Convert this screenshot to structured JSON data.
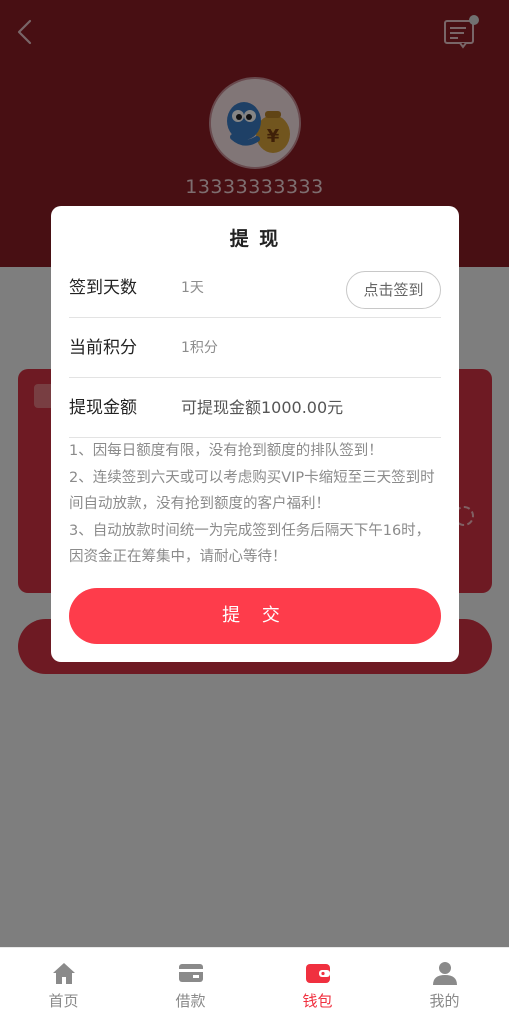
{
  "profile": {
    "phone": "13333333333"
  },
  "modal": {
    "title": "提 现",
    "rows": [
      {
        "label": "签到天数",
        "value": "1天",
        "button": "点击签到"
      },
      {
        "label": "当前积分",
        "value": "1积分"
      },
      {
        "label": "提现金额",
        "value": "可提现金额1000.00元"
      }
    ],
    "notes": [
      "1、因每日额度有限，没有抢到额度的排队签到！",
      "2、连续签到六天或可以考虑购买VIP卡缩短至三天签到时间自动放款，没有抢到额度的客户福利！",
      "3、自动放款时间统一为完成签到任务后隔天下午16时，因资金正在筹集中，请耐心等待！"
    ],
    "submit": "提 交"
  },
  "tabbar": {
    "active_color": "#f0303f",
    "items": [
      {
        "label": "首页",
        "icon": "home-icon"
      },
      {
        "label": "借款",
        "icon": "card-icon"
      },
      {
        "label": "钱包",
        "icon": "wallet-icon",
        "active": true
      },
      {
        "label": "我的",
        "icon": "user-icon"
      }
    ]
  },
  "colors": {
    "header": "#8a1d25",
    "card": "#d43343",
    "primary": "#fe3c4b"
  }
}
